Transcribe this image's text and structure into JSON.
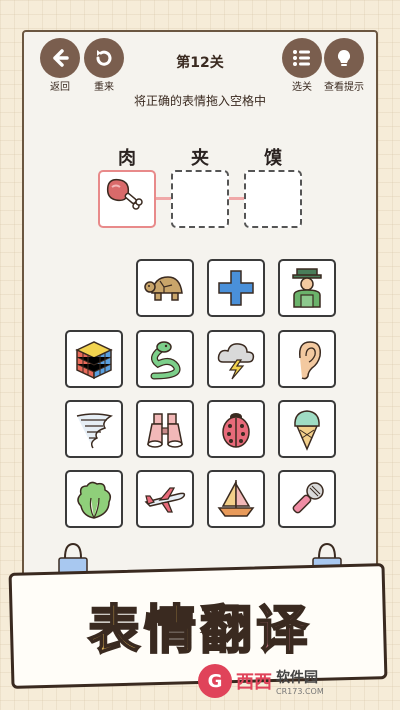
{
  "header": {
    "back_label": "返回",
    "restart_label": "重来",
    "level_title": "第12关",
    "select_level_label": "选关",
    "hint_label": "查看提示"
  },
  "instruction": "将正确的表情拖入空格中",
  "answer": {
    "characters": [
      "肉",
      "夹",
      "馍"
    ],
    "slots": [
      {
        "filled": true,
        "icon": "meat-icon"
      },
      {
        "filled": false
      },
      {
        "filled": false
      }
    ]
  },
  "tiles": [
    [
      "turtle-icon",
      "plus-icon",
      "farmer-icon"
    ],
    [
      "rubiks-cube-icon",
      "snake-icon",
      "thunder-cloud-icon",
      "ear-icon"
    ],
    [
      "tornado-icon",
      "binoculars-icon",
      "ladybug-icon",
      "ice-cream-icon"
    ],
    [
      "lettuce-icon",
      "airplane-icon",
      "sailboat-icon",
      "microphone-icon"
    ]
  ],
  "banner": {
    "chars": [
      "表",
      "情",
      "翻",
      "译"
    ],
    "colors": [
      "#f6c85f",
      "#f6c85f",
      "#f08ca4",
      "#f08ca4"
    ]
  },
  "watermark": {
    "logo": "G",
    "name": "西西",
    "title": "软件园",
    "url": "CR173.COM"
  },
  "colors": {
    "button_brown": "#7a5e4e",
    "slot_accent": "#e88a8a"
  }
}
